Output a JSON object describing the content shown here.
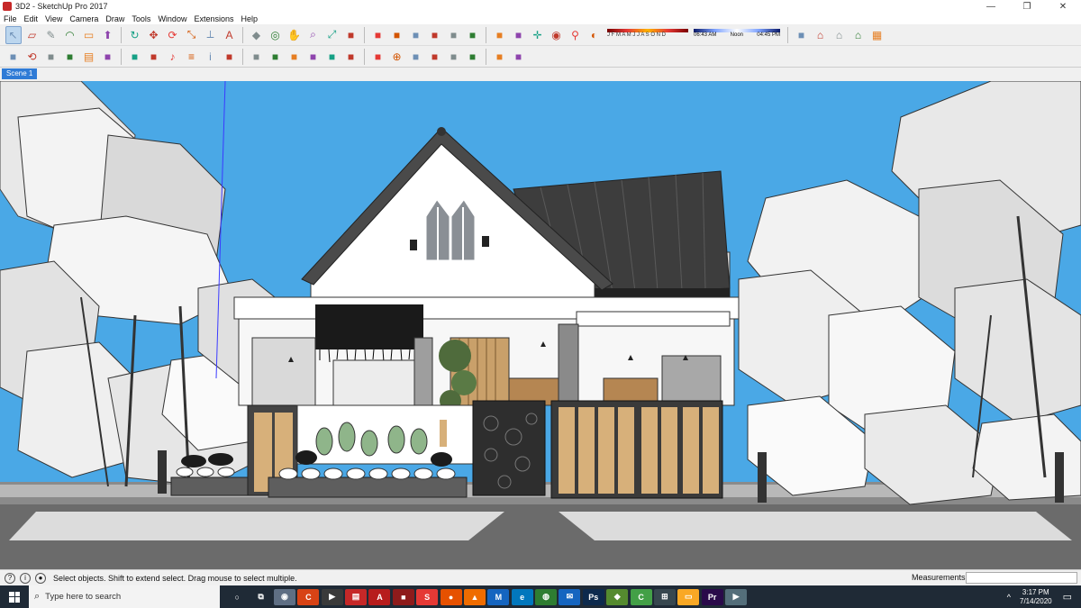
{
  "window": {
    "title": "3D2 - SketchUp Pro 2017",
    "minimize_glyph": "—",
    "maximize_glyph": "❐",
    "close_glyph": "✕"
  },
  "menu": [
    "File",
    "Edit",
    "View",
    "Camera",
    "Draw",
    "Tools",
    "Window",
    "Extensions",
    "Help"
  ],
  "toolbar": {
    "row1_icons": [
      "select-icon",
      "eraser-icon",
      "pencil-icon",
      "arc-icon",
      "rectangle-icon",
      "push-pull-icon",
      "follow-me-icon",
      "move-icon",
      "rotate-icon",
      "scale-icon",
      "tape-measure-icon",
      "text-icon",
      "paint-bucket-icon",
      "orbit-icon",
      "pan-icon",
      "zoom-icon",
      "zoom-extents-icon",
      "component-icon",
      "group-icon",
      "section-icon",
      "xray-icon",
      "wireframe-icon",
      "hidden-line-icon",
      "shaded-icon",
      "textured-icon",
      "monochrome-icon",
      "axes-icon",
      "camera-icon",
      "walk-icon",
      "shadow-icon",
      "warehouse-icon",
      "home-icon",
      "house-icon",
      "house-outline-icon",
      "garage-icon"
    ],
    "row2_icons": [
      "extension-warehouse-icon",
      "refresh-icon",
      "import-icon",
      "export-icon",
      "print-icon",
      "style-icon",
      "layer-icon",
      "scene-icon",
      "sound-icon",
      "settings-icon",
      "info-icon",
      "front-view-icon",
      "back-view-icon",
      "left-view-icon",
      "right-view-icon",
      "top-view-icon",
      "bottom-view-icon",
      "iso-view-icon",
      "perspective-icon",
      "geo-location-icon",
      "sandbox-icon",
      "terrain-icon",
      "drape-icon",
      "stamp-icon",
      "smoove-icon",
      "flip-edge-icon"
    ],
    "shadow": {
      "months": "J F M A M J J A S O N D",
      "time_start": "06:43 AM",
      "time_mid": "Noon",
      "time_end": "04:45 PM"
    }
  },
  "scene_tab": "Scene 1",
  "status": {
    "message": "Select objects. Shift to extend select. Drag mouse to select multiple.",
    "measurements_label": "Measurements",
    "measurements_value": ""
  },
  "taskbar": {
    "search_placeholder": "Type here to search",
    "apps": [
      {
        "name": "cortana-icon",
        "color": "#1f2a36",
        "glyph": "○"
      },
      {
        "name": "task-view-icon",
        "color": "#1f2a36",
        "glyph": "⧉"
      },
      {
        "name": "camera-app-icon",
        "color": "#5f6f84",
        "glyph": "◉"
      },
      {
        "name": "ccleaner-icon",
        "color": "#d84315",
        "glyph": "C"
      },
      {
        "name": "media-player-icon",
        "color": "#3a3a3a",
        "glyph": "▶"
      },
      {
        "name": "pdf-icon",
        "color": "#c62828",
        "glyph": "▤"
      },
      {
        "name": "acrobat-icon",
        "color": "#b71c1c",
        "glyph": "A"
      },
      {
        "name": "red-app-icon",
        "color": "#8e1b1b",
        "glyph": "■"
      },
      {
        "name": "sketchup-icon",
        "color": "#e53935",
        "glyph": "S"
      },
      {
        "name": "firefox-icon",
        "color": "#e65100",
        "glyph": "●"
      },
      {
        "name": "vlc-icon",
        "color": "#ef6c00",
        "glyph": "▲"
      },
      {
        "name": "malwarebytes-icon",
        "color": "#1565c0",
        "glyph": "M"
      },
      {
        "name": "edge-icon",
        "color": "#0277bd",
        "glyph": "e"
      },
      {
        "name": "chrome-icon",
        "color": "#2e7d32",
        "glyph": "◍"
      },
      {
        "name": "mail-icon",
        "color": "#1565c0",
        "glyph": "✉"
      },
      {
        "name": "photoshop-icon",
        "color": "#0d2a4d",
        "glyph": "Ps"
      },
      {
        "name": "nvidia-icon",
        "color": "#558b2f",
        "glyph": "◆"
      },
      {
        "name": "camtasia-icon",
        "color": "#43a047",
        "glyph": "C"
      },
      {
        "name": "store-icon",
        "color": "#37474f",
        "glyph": "⊞"
      },
      {
        "name": "folder-icon",
        "color": "#f9a825",
        "glyph": "▭"
      },
      {
        "name": "premiere-icon",
        "color": "#2a0a4a",
        "glyph": "Pr"
      },
      {
        "name": "video-icon",
        "color": "#546e7a",
        "glyph": "▶"
      }
    ],
    "tray_chevron": "^",
    "time": "3:17 PM",
    "date": "7/14/2020"
  },
  "colors": {
    "sky": "#4aa8e6",
    "roof": "#3d3d3d",
    "wood": "#d7b07a",
    "wall": "#ffffff",
    "street": "#6e6e6e"
  }
}
